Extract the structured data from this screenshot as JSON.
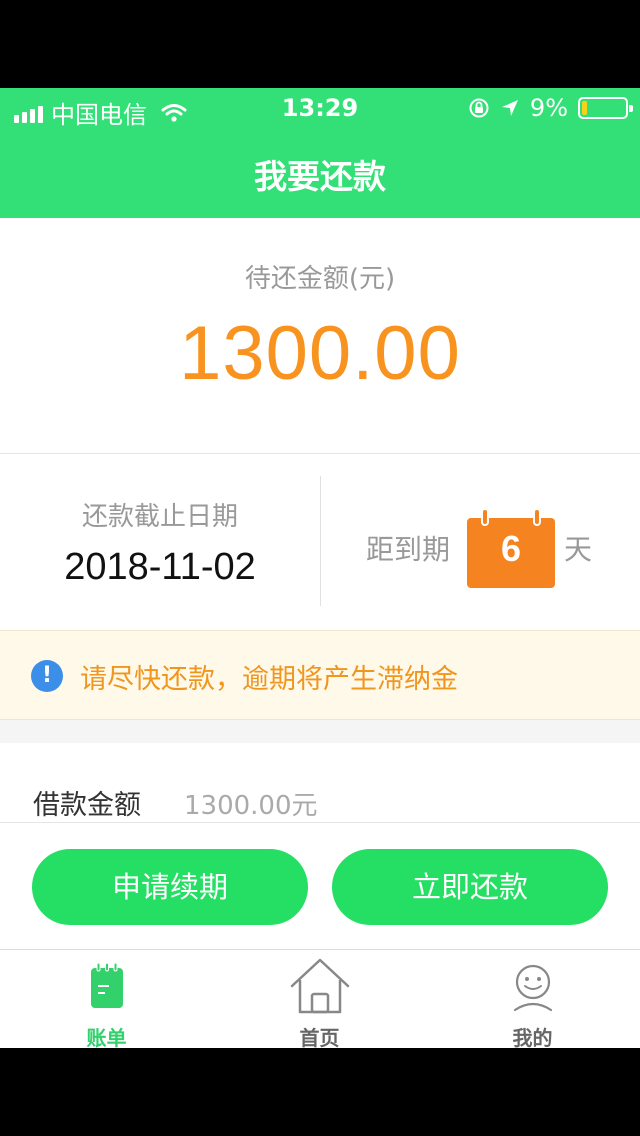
{
  "status_bar": {
    "carrier": "中国电信",
    "time": "13:29",
    "battery": "9%",
    "battery_level": 0.09
  },
  "header": {
    "title": "我要还款"
  },
  "amount": {
    "label": "待还金额(元)",
    "value": "1300.00",
    "color": "#f7931e"
  },
  "due": {
    "label": "还款截止日期",
    "date": "2018-11-02",
    "countdown_prefix": "距到期",
    "days": "6",
    "countdown_suffix": "天"
  },
  "notice": {
    "icon": "info-icon",
    "text": "请尽快还款，逾期将产生滞纳金"
  },
  "loan": {
    "label": "借款金额",
    "value": "1300.00元"
  },
  "actions": {
    "renew_label": "申请续期",
    "repay_label": "立即还款",
    "button_color": "#25df65"
  },
  "tabbar": {
    "items": [
      {
        "label": "账单",
        "icon": "bill-icon",
        "active": true
      },
      {
        "label": "首页",
        "icon": "home-icon",
        "active": false
      },
      {
        "label": "我的",
        "icon": "user-icon",
        "active": false
      }
    ]
  },
  "colors": {
    "brand_green": "#33e077",
    "accent_orange": "#f58420"
  }
}
